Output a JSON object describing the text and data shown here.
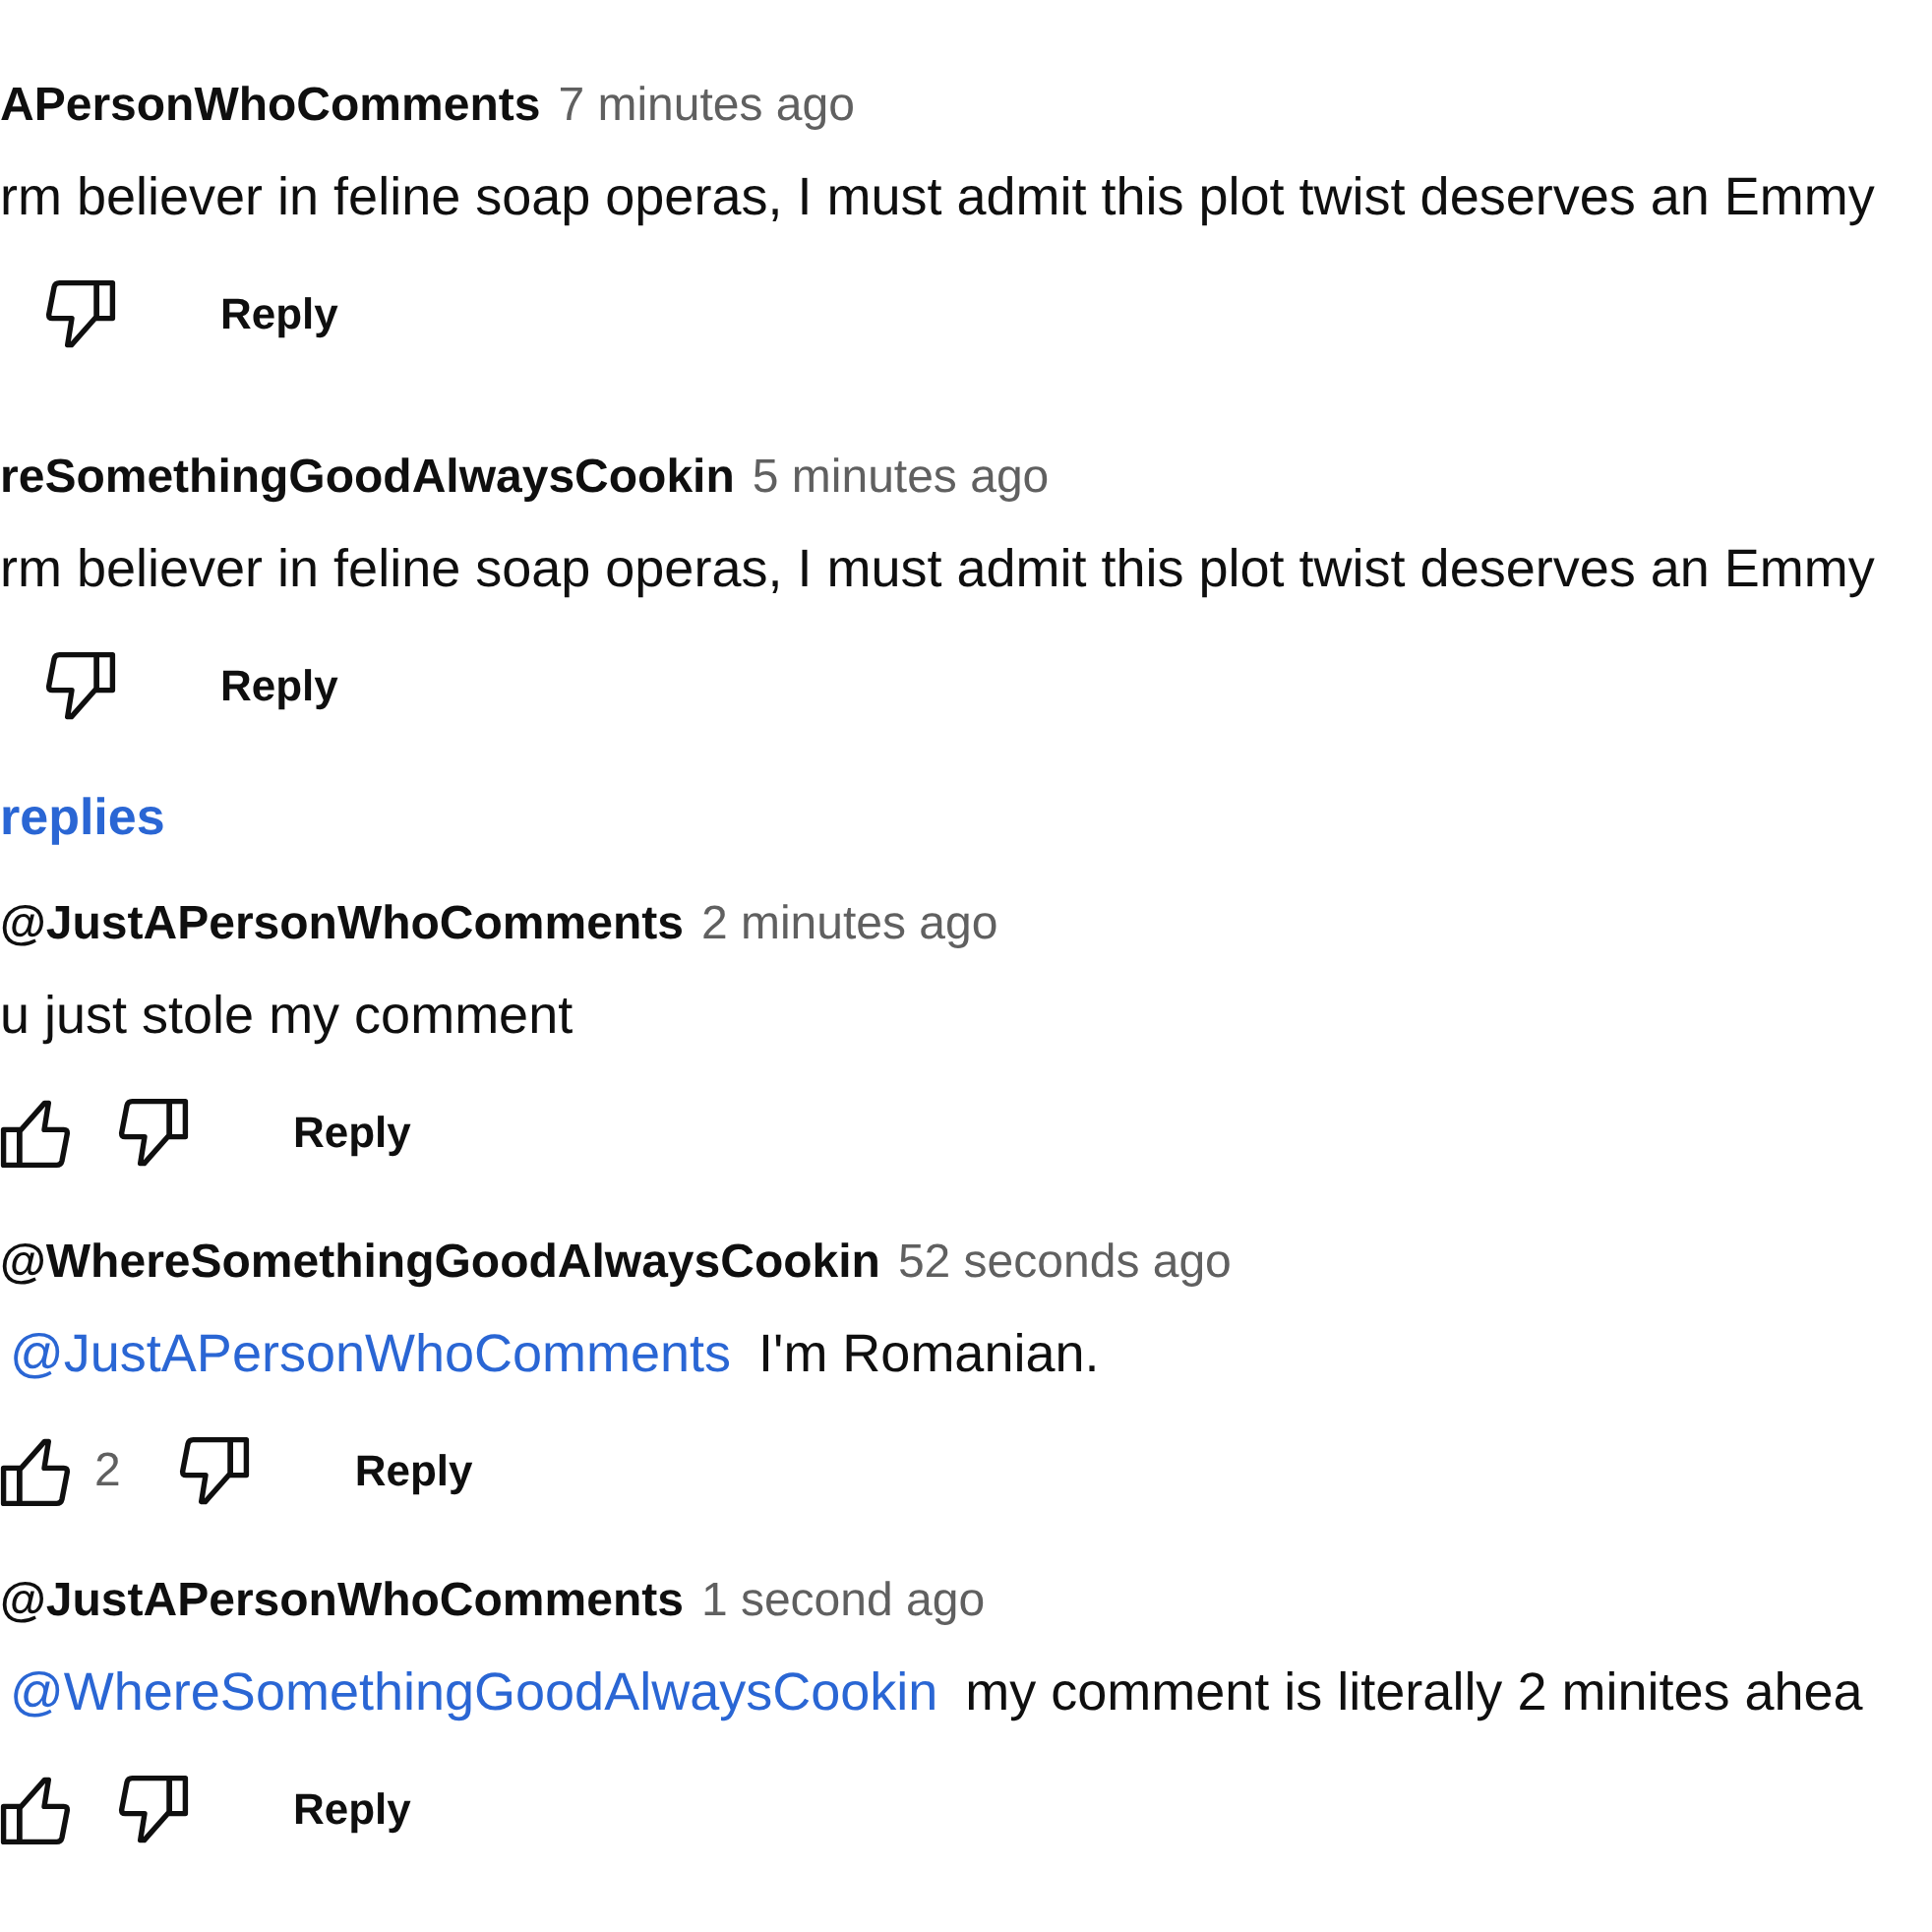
{
  "comments": [
    {
      "author": "APersonWhoComments",
      "time": "7 minutes ago",
      "text": "rm believer in feline soap operas, I must admit this plot twist deserves an Emmy",
      "reply_label": "Reply"
    },
    {
      "author": "reSomethingGoodAlwaysCookin",
      "time": "5 minutes ago",
      "text": "rm believer in feline soap operas, I must admit this plot twist deserves an Emmy",
      "reply_label": "Reply"
    }
  ],
  "replies_toggle": {
    "label": "replies"
  },
  "replies": [
    {
      "author": "@JustAPersonWhoComments",
      "time": "2 minutes ago",
      "text": "u just stole my comment",
      "reply_label": "Reply"
    },
    {
      "author": "@WhereSomethingGoodAlwaysCookin",
      "time": "52 seconds ago",
      "mention": "@JustAPersonWhoComments",
      "text": "I'm Romanian.",
      "likes": "2",
      "reply_label": "Reply"
    },
    {
      "author": "@JustAPersonWhoComments",
      "time": "1 second ago",
      "mention": "@WhereSomethingGoodAlwaysCookin",
      "text": "my comment is literally 2 minites ahea",
      "reply_label": "Reply"
    }
  ]
}
